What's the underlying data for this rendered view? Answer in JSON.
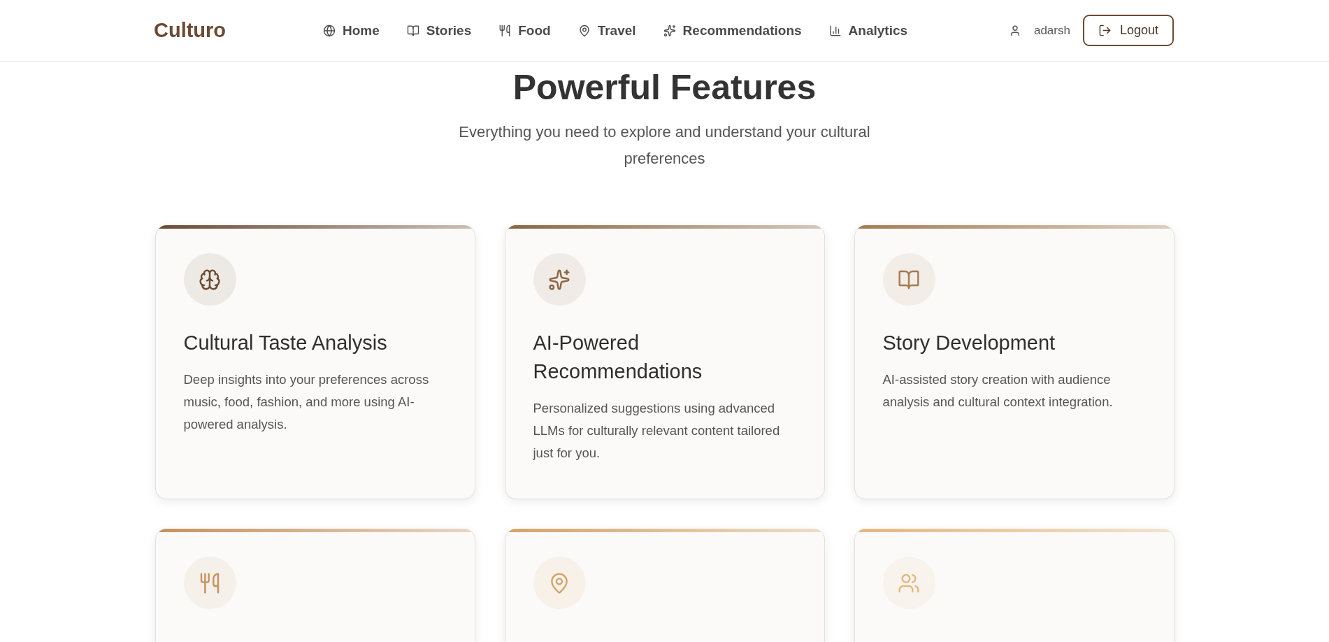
{
  "header": {
    "logo": "Culturo",
    "nav": [
      "Home",
      "Stories",
      "Food",
      "Travel",
      "Recommendations",
      "Analytics"
    ],
    "user": "adarsh",
    "logout": "Logout"
  },
  "hero": {
    "title": "Powerful Features",
    "subtitle": "Everything you need to explore and understand your cultural preferences"
  },
  "features": [
    {
      "title": "Cultural Taste Analysis",
      "description": "Deep insights into your preferences across music, food, fashion, and more using AI-powered analysis.",
      "color": "#6b4a34"
    },
    {
      "title": "AI-Powered Recommendations",
      "description": "Personalized suggestions using advanced LLMs for culturally relevant content tailored just for you.",
      "color": "#8b6440"
    },
    {
      "title": "Story Development",
      "description": "AI-assisted story creation with audience analysis and cultural context integration.",
      "color": "#a57a50"
    },
    {
      "color": "#c4925e"
    },
    {
      "color": "#d2a468"
    },
    {
      "color": "#e2b880"
    }
  ]
}
